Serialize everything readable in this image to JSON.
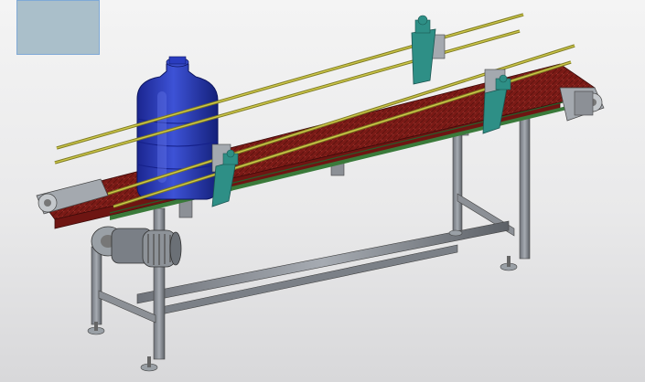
{
  "viewport": {
    "background_top": "#f4f4f4",
    "background_bottom": "#d8d8da",
    "thumbnail": {
      "fill": "#aabfca",
      "border": "#7fa9d6"
    }
  },
  "model": {
    "name_hidden": "",
    "colors": {
      "frame": "#8c9096",
      "frame_dark": "#55595f",
      "belt": "#7a1a16",
      "belt_edge": "#4d0f0c",
      "rail": "#b8b235",
      "rail_dark": "#7d7a22",
      "guide_green": "#3a7a3a",
      "bracket": "#2e8f86",
      "bottle": "#1f2ea8",
      "bottle_light": "#3b4fd1",
      "motor": "#7a7f86",
      "pulley": "#9aa0a6"
    }
  }
}
